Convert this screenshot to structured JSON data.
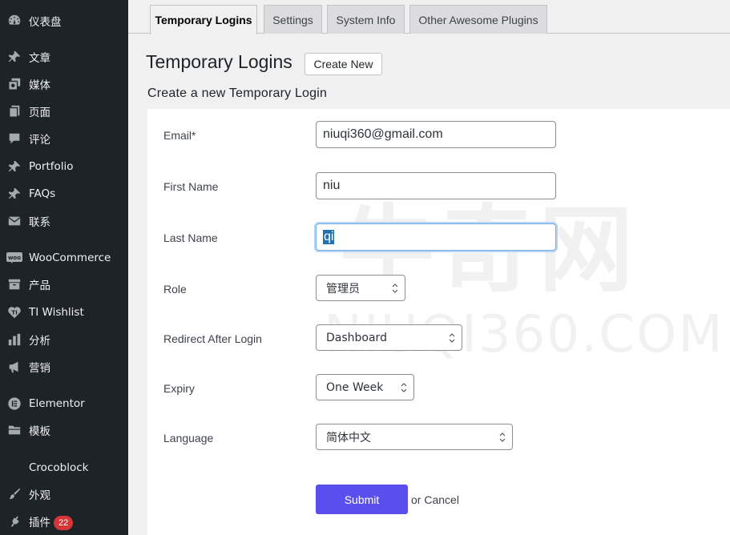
{
  "sidebar": {
    "items": [
      {
        "label": "仪表盘",
        "icon": "dashboard-icon"
      },
      {
        "label": "文章",
        "icon": "pin-icon"
      },
      {
        "label": "媒体",
        "icon": "media-icon"
      },
      {
        "label": "页面",
        "icon": "pages-icon"
      },
      {
        "label": "评论",
        "icon": "comment-icon"
      },
      {
        "label": "Portfolio",
        "icon": "pin-icon"
      },
      {
        "label": "FAQs",
        "icon": "pin-icon"
      },
      {
        "label": "联系",
        "icon": "mail-icon"
      },
      {
        "label": "WooCommerce",
        "icon": "woo-icon"
      },
      {
        "label": "产品",
        "icon": "archive-icon"
      },
      {
        "label": "TI Wishlist",
        "icon": "heart-icon"
      },
      {
        "label": "分析",
        "icon": "chart-icon"
      },
      {
        "label": "营销",
        "icon": "megaphone-icon"
      },
      {
        "label": "Elementor",
        "icon": "elementor-icon"
      },
      {
        "label": "模板",
        "icon": "folder-icon"
      },
      {
        "label": "Crocoblock",
        "icon": ""
      },
      {
        "label": "外观",
        "icon": "brush-icon"
      },
      {
        "label": "插件",
        "icon": "plugin-icon",
        "badge": "22"
      }
    ]
  },
  "tabs": [
    {
      "label": "Temporary Logins",
      "active": true
    },
    {
      "label": "Settings",
      "active": false
    },
    {
      "label": "System Info",
      "active": false
    },
    {
      "label": "Other Awesome Plugins",
      "active": false
    }
  ],
  "page": {
    "title": "Temporary Logins",
    "create_new": "Create New",
    "subtitle": "Create a new Temporary Login"
  },
  "watermark": {
    "logo_text": "牛奇网",
    "domain_text": "NIUQI360.COM"
  },
  "form": {
    "email_label": "Email*",
    "email_value": "niuqi360@gmail.com",
    "first_name_label": "First Name",
    "first_name_value": "niu",
    "last_name_label": "Last Name",
    "last_name_value": "qi",
    "role_label": "Role",
    "role_value": "管理员",
    "redirect_label": "Redirect After Login",
    "redirect_value": "Dashboard",
    "expiry_label": "Expiry",
    "expiry_value": "One Week",
    "language_label": "Language",
    "language_value": "简体中文",
    "submit": "Submit",
    "or": "or",
    "cancel": "Cancel"
  },
  "colors": {
    "sidebar_bg": "#1d2327",
    "submit_bg": "#5a4fee",
    "badge_bg": "#d63638",
    "focus_border": "#72aee6"
  }
}
